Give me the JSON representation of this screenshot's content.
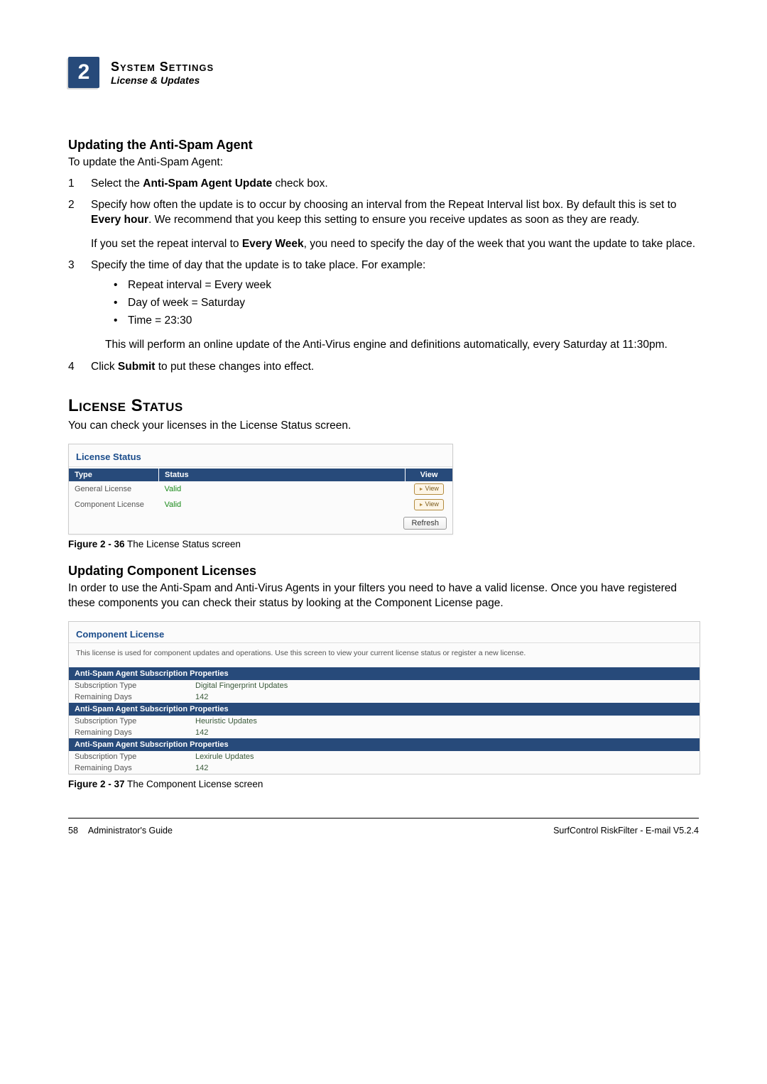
{
  "header": {
    "chapter_number": "2",
    "title": "System Settings",
    "subtitle": "License & Updates"
  },
  "section1": {
    "heading": "Updating the Anti-Spam Agent",
    "intro": "To update the Anti-Spam Agent:",
    "step1_pre": "Select the ",
    "step1_bold": "Anti-Spam Agent Update",
    "step1_post": " check box.",
    "step2_a": "Specify how often the update is to occur by choosing an interval from the Repeat Interval list box. By default this is set to ",
    "step2_bold1": "Every hour",
    "step2_b": ". We recommend that you keep this setting to ensure you receive updates as soon as they are ready.",
    "step2_para2_a": "If you set the repeat interval to ",
    "step2_bold2": "Every Week",
    "step2_para2_b": ", you need to specify the day of the week that you want the update to take place.",
    "step3_intro": "Specify the time of day that the update is to take place. For example:",
    "step3_bullets": [
      "Repeat interval = Every week",
      "Day of week = Saturday",
      "Time = 23:30"
    ],
    "step3_note": "This will perform an online update of the Anti-Virus engine and definitions automatically, every Saturday at 11:30pm.",
    "step4_pre": "Click ",
    "step4_bold": "Submit",
    "step4_post": " to put these changes into effect."
  },
  "section2": {
    "heading": "License Status",
    "intro": "You can check your licenses in the License Status screen.",
    "screenshot": {
      "title": "License Status",
      "cols": {
        "type": "Type",
        "status": "Status",
        "view": "View"
      },
      "rows": [
        {
          "type": "General License",
          "status": "Valid",
          "view": "View"
        },
        {
          "type": "Component License",
          "status": "Valid",
          "view": "View"
        }
      ],
      "refresh": "Refresh"
    },
    "caption_bold": "Figure 2 - 36",
    "caption_text": " The License Status screen"
  },
  "section3": {
    "heading": "Updating Component Licenses",
    "intro": "In order to use the Anti-Spam and Anti-Virus Agents in your filters you need to have a valid license. Once you have registered these components you can check their status by looking at the Component License page.",
    "screenshot": {
      "title": "Component License",
      "desc": "This license is used for component updates and operations. Use this screen to view your current license status or register a new license.",
      "groups": [
        {
          "header": "Anti-Spam Agent Subscription Properties",
          "rows": [
            {
              "label": "Subscription Type",
              "value": "Digital Fingerprint Updates"
            },
            {
              "label": "Remaining Days",
              "value": "142"
            }
          ]
        },
        {
          "header": "Anti-Spam Agent Subscription Properties",
          "rows": [
            {
              "label": "Subscription Type",
              "value": "Heuristic Updates"
            },
            {
              "label": "Remaining Days",
              "value": "142"
            }
          ]
        },
        {
          "header": "Anti-Spam Agent Subscription Properties",
          "rows": [
            {
              "label": "Subscription Type",
              "value": "Lexirule Updates"
            },
            {
              "label": "Remaining Days",
              "value": "142"
            }
          ]
        }
      ]
    },
    "caption_bold": "Figure 2 - 37",
    "caption_text": " The Component License screen"
  },
  "footer": {
    "page": "58",
    "left": "Administrator's Guide",
    "right": "SurfControl RiskFilter - E-mail V5.2.4"
  }
}
